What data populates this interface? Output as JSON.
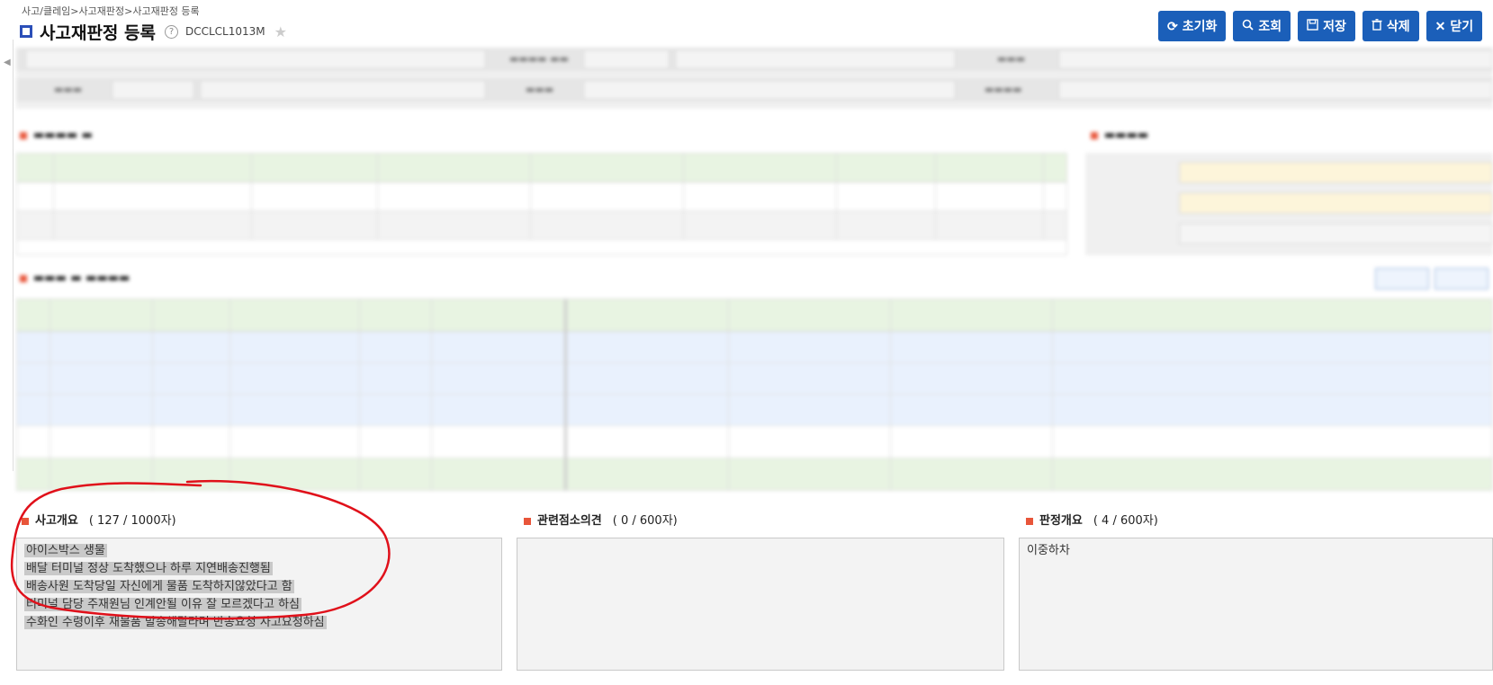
{
  "header": {
    "breadcrumb": "사고/클레임>사고재판정>사고재판정 등록",
    "title": "사고재판정 등록",
    "help": "?",
    "screen_code": "DCCLCL1013M",
    "star": "★"
  },
  "toolbar": {
    "reset_label": "초기화",
    "search_label": "조회",
    "save_label": "저장",
    "delete_label": "삭제",
    "close_label": "닫기",
    "reset_icon": "refresh-icon",
    "search_icon": "search-icon",
    "save_icon": "save-icon",
    "delete_icon": "trash-icon",
    "close_icon": "close-icon"
  },
  "sections": {
    "accident_summary": {
      "title": "사고개요",
      "count": "( 127 / 1000자)",
      "lines": [
        "아이스박스 생물",
        "배달 터미널 정상 도착했으나 하루 지연배송진행됨",
        "배송사원 도착당일 자신에게 물품 도착하지않았다고 함",
        "터미널 담당 주재원님 인계안될 이유 잘 모르겠다고 하심",
        "수화인 수령이후 재물품 발송해달라며 반송요청 사고요청하심"
      ]
    },
    "related_opinion": {
      "title": "관련점소의견",
      "count": "( 0 / 600자)",
      "text": ""
    },
    "judgment_summary": {
      "title": "판정개요",
      "count": "( 4 / 600자)",
      "text": "이중하차"
    }
  },
  "colors": {
    "primary_button": "#1b5fb9",
    "section_marker": "#e8553a",
    "grid_header": "#e8f4e2",
    "annotation_circle": "#e0101a"
  }
}
